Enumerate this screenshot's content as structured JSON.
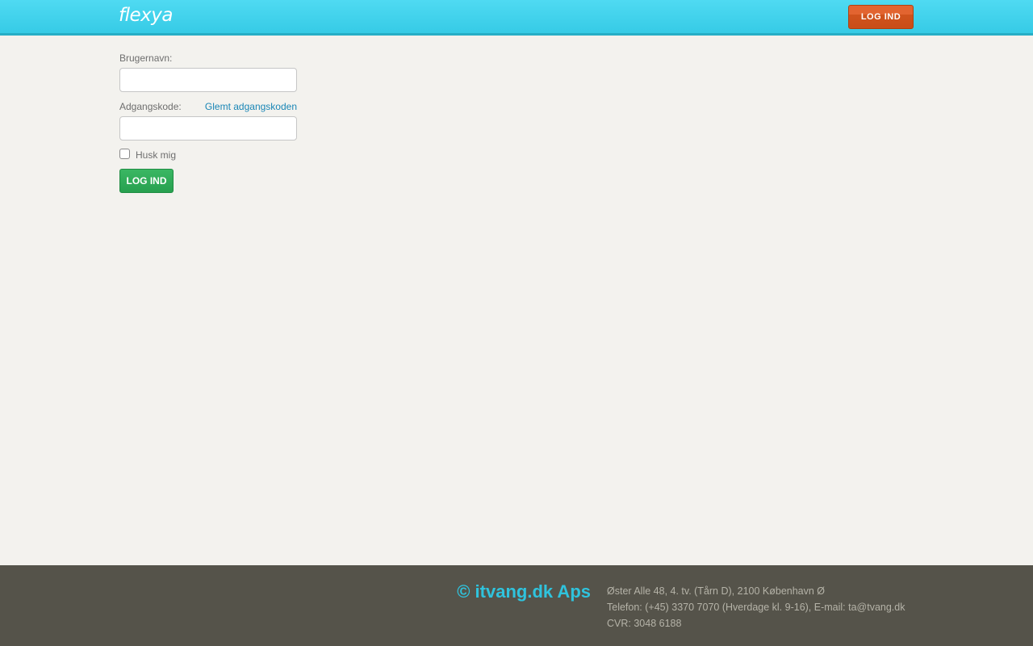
{
  "header": {
    "logo_text": "flexya",
    "login_button": "LOG IND"
  },
  "form": {
    "username_label": "Brugernavn:",
    "username_value": "",
    "password_label": "Adgangskode:",
    "password_value": "",
    "forgot_link": "Glemt adgangskoden",
    "remember_label": "Husk mig",
    "remember_checked": false,
    "submit_label": "LOG IND"
  },
  "footer": {
    "copyright": "© itvang.dk Aps",
    "address": "Øster Alle 48, 4. tv. (Tårn D), 2100 København Ø",
    "phone": "Telefon: (+45) 3370 7070 (Hverdage kl. 9-16), E-mail: ta@tvang.dk",
    "cvr": "CVR: 3048 6188"
  },
  "colors": {
    "header_bg": "#43d3ec",
    "accent_orange": "#d4561f",
    "accent_green": "#2daa58",
    "link_blue": "#1a86b6",
    "footer_bg": "#55534a",
    "footer_brand": "#2fc3dd"
  }
}
